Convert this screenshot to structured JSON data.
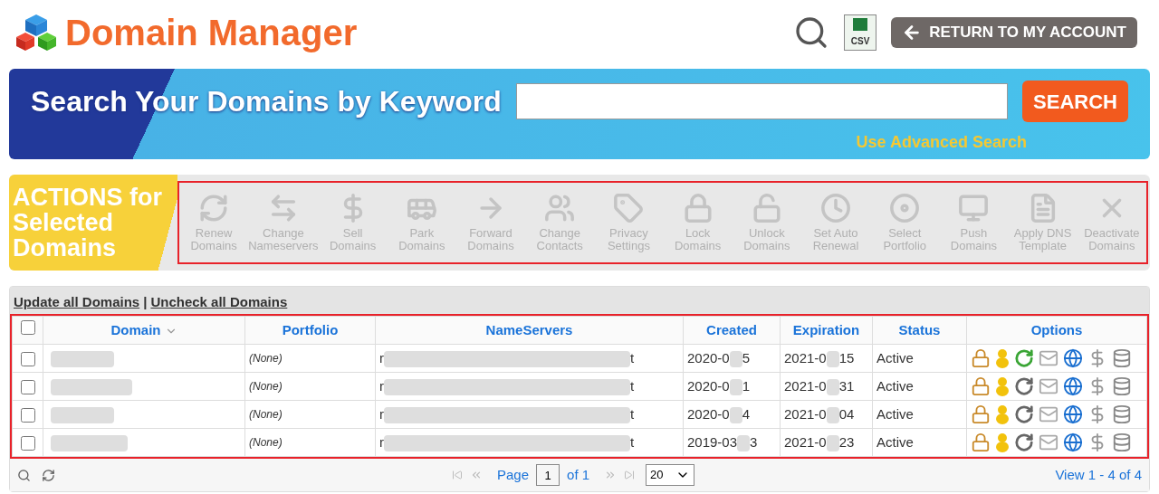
{
  "header": {
    "title": "Domain Manager",
    "return_button": "RETURN TO MY ACCOUNT",
    "csv_label": "CSV"
  },
  "search_banner": {
    "heading": "Search Your Domains by Keyword",
    "button": "SEARCH",
    "advanced_link": "Use Advanced Search"
  },
  "actions": {
    "title_lines": [
      "ACTIONS for",
      "Selected",
      "Domains"
    ],
    "highlighted": true,
    "items": [
      {
        "kind": "renew",
        "label": "Renew Domains",
        "disabled": true
      },
      {
        "kind": "nameservers",
        "label": "Change Nameservers",
        "disabled": true
      },
      {
        "kind": "sell",
        "label": "Sell Domains",
        "disabled": true
      },
      {
        "kind": "park",
        "label": "Park Domains",
        "disabled": true
      },
      {
        "kind": "forward",
        "label": "Forward Domains",
        "disabled": true
      },
      {
        "kind": "contacts",
        "label": "Change Contacts",
        "disabled": true
      },
      {
        "kind": "privacy",
        "label": "Privacy Settings",
        "disabled": true
      },
      {
        "kind": "lock",
        "label": "Lock Domains",
        "disabled": true
      },
      {
        "kind": "unlock",
        "label": "Unlock Domains",
        "disabled": true
      },
      {
        "kind": "autorenew",
        "label": "Set Auto Renewal",
        "disabled": true
      },
      {
        "kind": "portfolio",
        "label": "Select Portfolio",
        "disabled": true
      },
      {
        "kind": "push",
        "label": "Push Domains",
        "disabled": true
      },
      {
        "kind": "dns",
        "label": "Apply DNS Template",
        "disabled": true
      },
      {
        "kind": "deactivate",
        "label": "Deactivate Domains",
        "disabled": true
      }
    ]
  },
  "table": {
    "links": [
      "Update all Domains",
      "Uncheck all Domains"
    ],
    "separator": "|",
    "highlighted": true,
    "select_all_checked": false,
    "columns": [
      "Domain",
      "Portfolio",
      "NameServers",
      "Created",
      "Expiration",
      "Status",
      "Options"
    ],
    "rows": [
      {
        "checked": false,
        "portfolio": "(None)",
        "nameservers": {
          "start": "r",
          "end": "t"
        },
        "created": {
          "start": "2020-0",
          "end": "5"
        },
        "expiration": {
          "start": "2021-0",
          "end": "15"
        },
        "status": "Active",
        "auto_renew": true
      },
      {
        "checked": false,
        "portfolio": "(None)",
        "nameservers": {
          "start": "r",
          "end": "t"
        },
        "created": {
          "start": "2020-0",
          "end": "1"
        },
        "expiration": {
          "start": "2021-0",
          "end": "31"
        },
        "status": "Active",
        "auto_renew": false
      },
      {
        "checked": false,
        "portfolio": "(None)",
        "nameservers": {
          "start": "r",
          "end": "t"
        },
        "created": {
          "start": "2020-0",
          "end": "4"
        },
        "expiration": {
          "start": "2021-0",
          "end": "04"
        },
        "status": "Active",
        "auto_renew": false
      },
      {
        "checked": false,
        "portfolio": "(None)",
        "nameservers": {
          "start": "r",
          "end": "t"
        },
        "created": {
          "start": "2019-03",
          "end": "3"
        },
        "expiration": {
          "start": "2021-0",
          "end": "23"
        },
        "status": "Active",
        "auto_renew": false
      }
    ]
  },
  "pager": {
    "page_label": "Page",
    "page_value": "1",
    "of_label": "of 1",
    "page_size": "20",
    "view_text": "View 1 - 4 of 4"
  }
}
